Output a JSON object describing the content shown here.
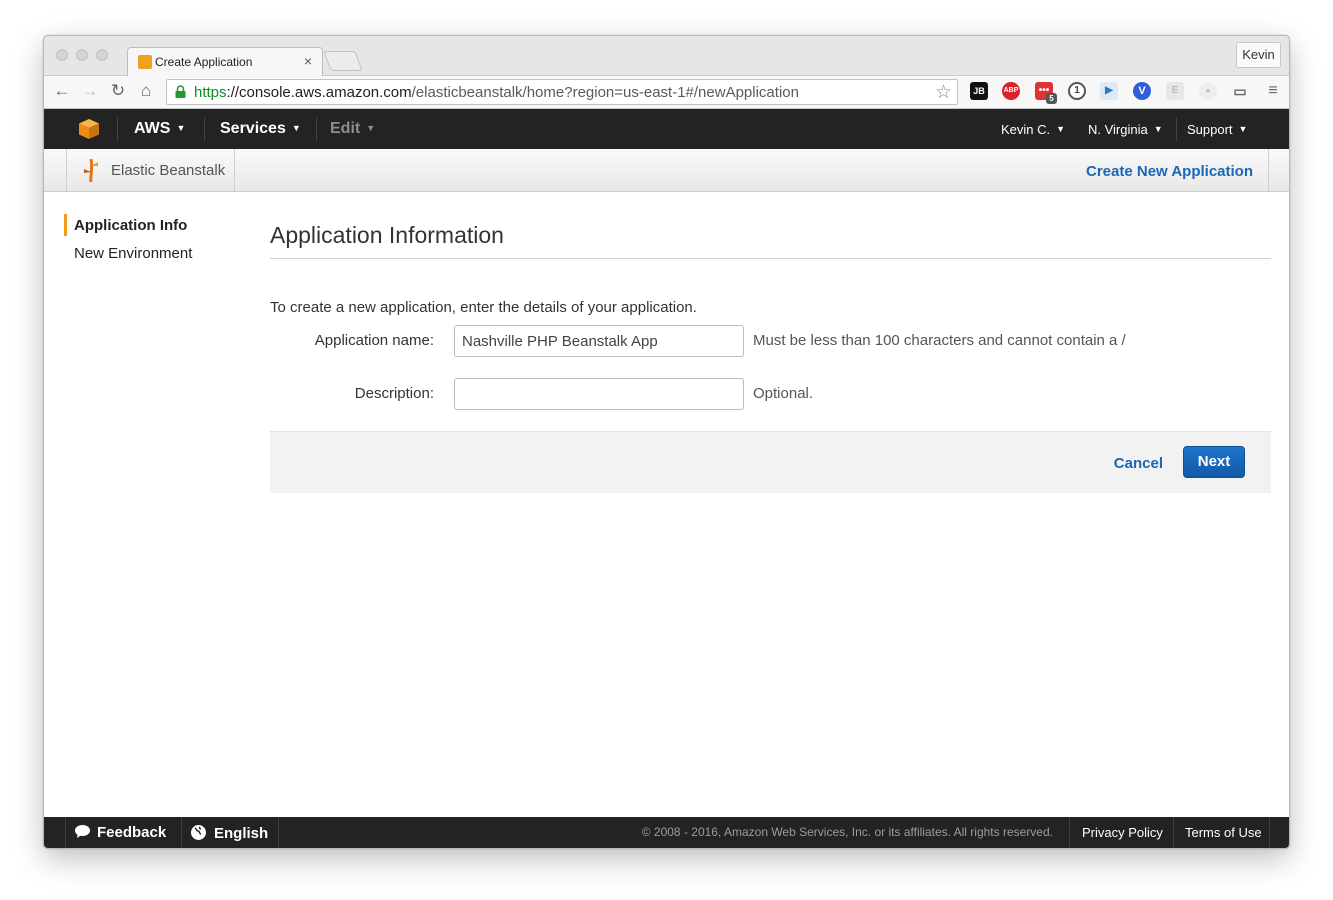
{
  "browser": {
    "tab_title": "Create Application",
    "tab_close": "×",
    "profile": "Kevin",
    "url": {
      "scheme": "https",
      "sep": "://",
      "host": "console.aws.amazon.com",
      "path": "/elasticbeanstalk/home?region=us-east-1#/newApplication"
    },
    "nav_icons": [
      "back-arrow-icon",
      "forward-arrow-icon",
      "reload-icon",
      "home-icon"
    ],
    "extensions": [
      "JB",
      "ABP",
      "•••",
      "1",
      "▶",
      "V",
      "E",
      "●",
      "cast",
      "menu"
    ],
    "extension_badge": "5"
  },
  "aws_nav": {
    "aws": "AWS",
    "services": "Services",
    "edit": "Edit",
    "user": "Kevin C.",
    "region": "N. Virginia",
    "support": "Support",
    "caret": "▼"
  },
  "service": {
    "name": "Elastic Beanstalk",
    "create_new": "Create New Application"
  },
  "sidenav": {
    "items": [
      {
        "label": "Application Info"
      },
      {
        "label": "New Environment"
      }
    ]
  },
  "form": {
    "title": "Application Information",
    "intro": "To create a new application, enter the details of your application.",
    "app_name_label": "Application name:",
    "app_name_value": "Nashville PHP Beanstalk App",
    "app_name_hint": "Must be less than 100 characters and cannot contain a /",
    "desc_label": "Description:",
    "desc_value": "",
    "desc_hint": "Optional.",
    "cancel": "Cancel",
    "next": "Next"
  },
  "footer": {
    "feedback": "Feedback",
    "language": "English",
    "copyright": "© 2008 - 2016, Amazon Web Services, Inc. or its affiliates. All rights reserved.",
    "privacy": "Privacy Policy",
    "terms": "Terms of Use"
  },
  "colors": {
    "aws_nav_bg": "#232323",
    "link_blue": "#1a66b7",
    "accent_orange": "#f39b1d",
    "url_green": "#138a25"
  }
}
